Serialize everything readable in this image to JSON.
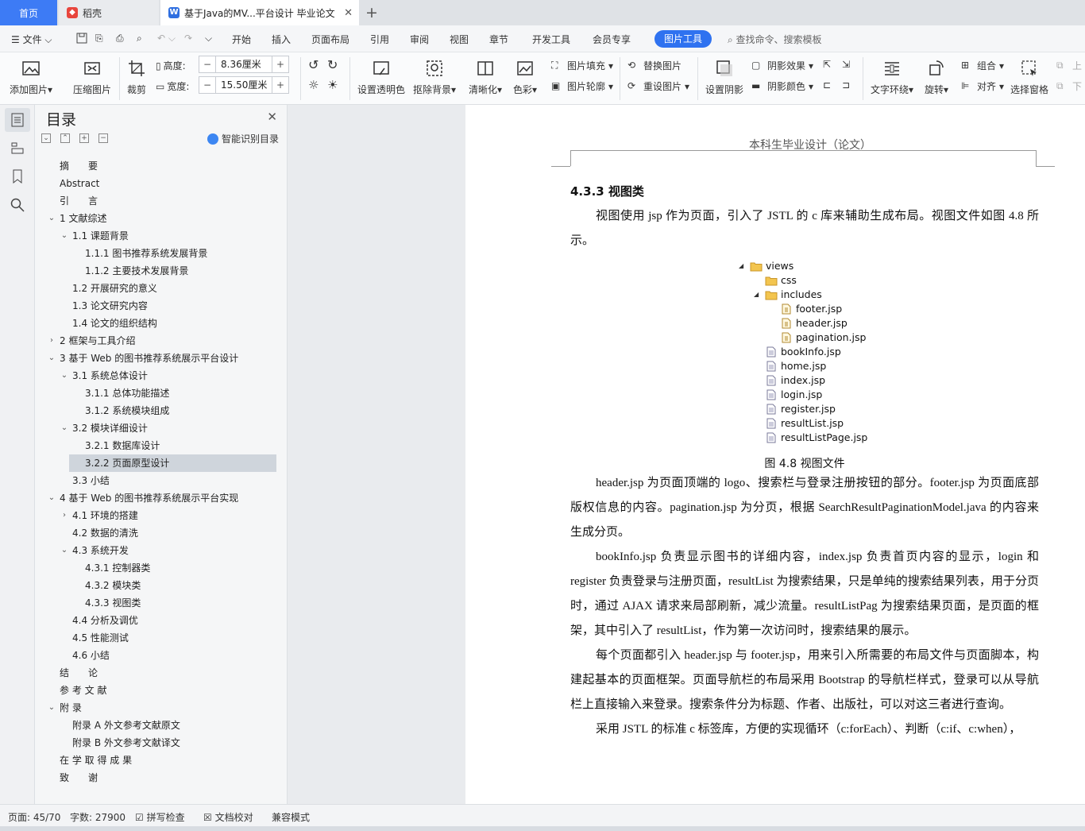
{
  "tabs": {
    "home": "首页",
    "daoke": "稻壳",
    "doc": "基于Java的MV...平台设计 毕业论文"
  },
  "menu": {
    "file": "文件",
    "items": [
      "开始",
      "插入",
      "页面布局",
      "引用",
      "审阅",
      "视图",
      "章节",
      "开发工具",
      "会员专享"
    ],
    "active": "图片工具",
    "search": "查找命令、搜索模板"
  },
  "ribbon": {
    "add_image": "添加图片",
    "compress": "压缩图片",
    "crop": "裁剪",
    "height_label": "高度:",
    "height_value": "8.36厘米",
    "width_label": "宽度:",
    "width_value": "15.50厘米",
    "transparent": "设置透明色",
    "remove_bg": "抠除背景",
    "sharpen": "清晰化",
    "color": "色彩",
    "fill": "图片填充",
    "outline": "图片轮廓",
    "replace": "替换图片",
    "reset": "重设图片",
    "shadow": "设置阴影",
    "shadow_effect": "阴影效果",
    "shadow_color": "阴影颜色",
    "wrap": "文字环绕",
    "rotate": "旋转",
    "group": "组合",
    "align": "对齐",
    "select_pane": "选择窗格",
    "up": "上",
    "down": "下"
  },
  "nav": {
    "title": "目录",
    "smart": "智能识别目录",
    "toc": [
      {
        "level": 0,
        "text": "摘　　要",
        "arrow": ""
      },
      {
        "level": 0,
        "text": "Abstract",
        "arrow": ""
      },
      {
        "level": 0,
        "text": "引　　言",
        "arrow": ""
      },
      {
        "level": 0,
        "text": "1  文献综述",
        "arrow": "open"
      },
      {
        "level": 1,
        "text": "1.1  课题背景",
        "arrow": "open"
      },
      {
        "level": 2,
        "text": "1.1.1  图书推荐系统发展背景",
        "arrow": ""
      },
      {
        "level": 2,
        "text": "1.1.2  主要技术发展背景",
        "arrow": ""
      },
      {
        "level": 1,
        "text": "1.2  开展研究的意义",
        "arrow": ""
      },
      {
        "level": 1,
        "text": "1.3  论文研究内容",
        "arrow": ""
      },
      {
        "level": 1,
        "text": "1.4  论文的组织结构",
        "arrow": ""
      },
      {
        "level": 0,
        "text": "2  框架与工具介绍",
        "arrow": "closed"
      },
      {
        "level": 0,
        "text": "3  基于 Web 的图书推荐系统展示平台设计",
        "arrow": "open"
      },
      {
        "level": 1,
        "text": "3.1  系统总体设计",
        "arrow": "open"
      },
      {
        "level": 2,
        "text": "3.1.1  总体功能描述",
        "arrow": ""
      },
      {
        "level": 2,
        "text": "3.1.2  系统模块组成",
        "arrow": ""
      },
      {
        "level": 1,
        "text": "3.2  模块详细设计",
        "arrow": "open"
      },
      {
        "level": 2,
        "text": "3.2.1  数据库设计",
        "arrow": ""
      },
      {
        "level": 2,
        "text": "3.2.2  页面原型设计",
        "arrow": "",
        "selected": true
      },
      {
        "level": 1,
        "text": "3.3  小结",
        "arrow": ""
      },
      {
        "level": 0,
        "text": "4  基于 Web 的图书推荐系统展示平台实现",
        "arrow": "open"
      },
      {
        "level": 1,
        "text": "4.1  环境的搭建",
        "arrow": "closed"
      },
      {
        "level": 1,
        "text": "4.2  数据的清洗",
        "arrow": ""
      },
      {
        "level": 1,
        "text": "4.3  系统开发",
        "arrow": "open"
      },
      {
        "level": 2,
        "text": "4.3.1  控制器类",
        "arrow": ""
      },
      {
        "level": 2,
        "text": "4.3.2  模块类",
        "arrow": ""
      },
      {
        "level": 2,
        "text": "4.3.3  视图类",
        "arrow": ""
      },
      {
        "level": 1,
        "text": "4.4  分析及调优",
        "arrow": ""
      },
      {
        "level": 1,
        "text": "4.5  性能测试",
        "arrow": ""
      },
      {
        "level": 1,
        "text": "4.6  小结",
        "arrow": ""
      },
      {
        "level": 0,
        "text": "结　　论",
        "arrow": ""
      },
      {
        "level": 0,
        "text": "参 考 文 献",
        "arrow": ""
      },
      {
        "level": 0,
        "text": "附 录",
        "arrow": "open"
      },
      {
        "level": 1,
        "text": "附录 A  外文参考文献原文",
        "arrow": ""
      },
      {
        "level": 1,
        "text": "附录 B  外文参考文献译文",
        "arrow": ""
      },
      {
        "level": 0,
        "text": "在 学 取 得 成 果",
        "arrow": ""
      },
      {
        "level": 0,
        "text": "致　　谢",
        "arrow": ""
      }
    ]
  },
  "doc": {
    "header": "本科生毕业设计（论文）",
    "section_title": "4.3.3 视图类",
    "intro": "视图使用 jsp 作为页面，引入了 JSTL 的 c 库来辅助生成布局。视图文件如图 4.8 所示。",
    "tree": [
      {
        "name": "views",
        "depth": 0,
        "type": "folder",
        "tri": "open"
      },
      {
        "name": "css",
        "depth": 1,
        "type": "folder",
        "tri": ""
      },
      {
        "name": "includes",
        "depth": 1,
        "type": "folder",
        "tri": "open"
      },
      {
        "name": "footer.jsp",
        "depth": 2,
        "type": "jsp",
        "tri": ""
      },
      {
        "name": "header.jsp",
        "depth": 2,
        "type": "jsp",
        "tri": ""
      },
      {
        "name": "pagination.jsp",
        "depth": 2,
        "type": "jsp",
        "tri": ""
      },
      {
        "name": "bookInfo.jsp",
        "depth": 1,
        "type": "file",
        "tri": ""
      },
      {
        "name": "home.jsp",
        "depth": 1,
        "type": "file",
        "tri": ""
      },
      {
        "name": "index.jsp",
        "depth": 1,
        "type": "file",
        "tri": ""
      },
      {
        "name": "login.jsp",
        "depth": 1,
        "type": "file",
        "tri": ""
      },
      {
        "name": "register.jsp",
        "depth": 1,
        "type": "file",
        "tri": ""
      },
      {
        "name": "resultList.jsp",
        "depth": 1,
        "type": "file",
        "tri": ""
      },
      {
        "name": "resultListPage.jsp",
        "depth": 1,
        "type": "file",
        "tri": ""
      }
    ],
    "caption": "图 4.8 视图文件",
    "p1": "header.jsp 为页面顶端的 logo、搜索栏与登录注册按钮的部分。footer.jsp 为页面底部版权信息的内容。pagination.jsp 为分页，根据 SearchResultPaginationModel.java 的内容来生成分页。",
    "p2": "bookInfo.jsp 负责显示图书的详细内容，index.jsp 负责首页内容的显示，login 和 register 负责登录与注册页面，resultList 为搜索结果，只是单纯的搜索结果列表，用于分页时，通过 AJAX 请求来局部刷新，减少流量。resultListPag 为搜索结果页面，是页面的框架，其中引入了 resultList，作为第一次访问时，搜索结果的展示。",
    "p3": "每个页面都引入 header.jsp 与 footer.jsp，用来引入所需要的布局文件与页面脚本，构建起基本的页面框架。页面导航栏的布局采用 Bootstrap 的导航栏样式，登录可以从导航栏上直接输入来登录。搜索条件分为标题、作者、出版社，可以对这三者进行查询。",
    "p4": "采用 JSTL 的标准 c 标签库，方便的实现循环（c:forEach）、判断（c:if、c:when），"
  },
  "status": {
    "page": "页面: 45/70",
    "words": "字数: 27900",
    "spell": "拼写检查",
    "proof": "文档校对",
    "compat": "兼容模式"
  },
  "colors": {
    "accent": "#2f72f0",
    "tab_home": "#3d7bf5",
    "selected_toc": "#cfd5dc"
  }
}
